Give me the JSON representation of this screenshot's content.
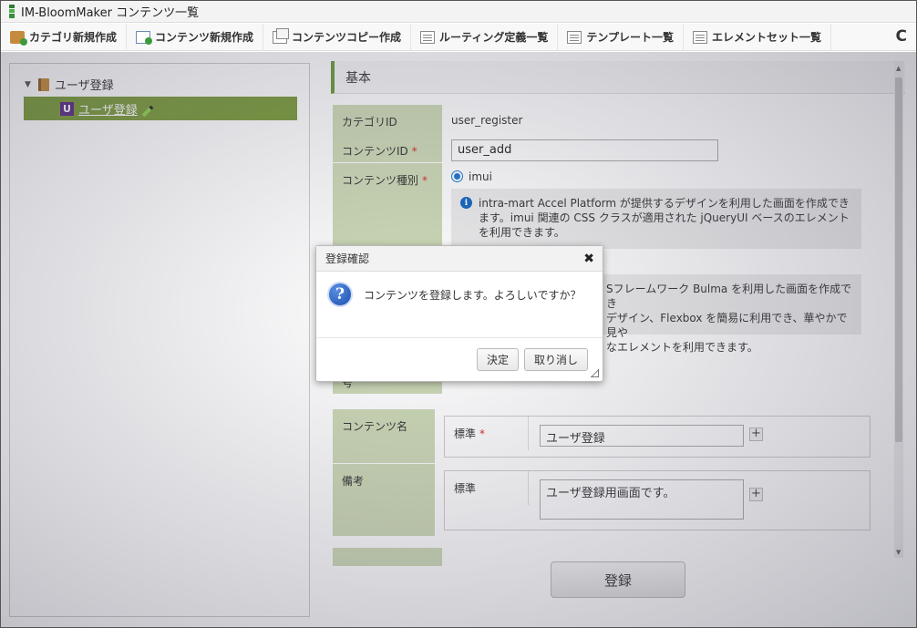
{
  "window": {
    "title": "IM-BloomMaker コンテンツ一覧"
  },
  "toolbar": {
    "items": [
      {
        "label": "カテゴリ新規作成",
        "icon": "category-new-icon"
      },
      {
        "label": "コンテンツ新規作成",
        "icon": "content-new-icon"
      },
      {
        "label": "コンテンツコピー作成",
        "icon": "content-copy-icon"
      },
      {
        "label": "ルーティング定義一覧",
        "icon": "list-icon"
      },
      {
        "label": "テンプレート一覧",
        "icon": "list-icon"
      },
      {
        "label": "エレメントセット一覧",
        "icon": "list-icon"
      }
    ],
    "refresh_glyph": "C"
  },
  "tree": {
    "root_label": "ユーザ登録",
    "child_badge": "U",
    "child_label": "ユーザ登録"
  },
  "form": {
    "section_title": "基本",
    "category_id_label": "カテゴリID",
    "category_id_value": "user_register",
    "content_id_label": "コンテンツID",
    "content_id_value": "user_add",
    "content_type_label": "コンテンツ種別",
    "content_type_option_imui": "imui",
    "imui_info": "intra-mart Accel Platform が提供するデザインを利用した画面を作成できます。imui 関連の CSS クラスが適用された jQueryUI ベースのエレメントを利用できます。",
    "bulma_info_line1": "Sフレームワーク Bulma を利用した画面を作成でき",
    "bulma_info_line2": "デザイン、Flexbox を簡易に利用でき、華やかで見や",
    "bulma_info_line3": "なエレメントを利用できます。",
    "partial_label": "号",
    "content_name_label": "コンテンツ名",
    "remarks_label": "備考",
    "lang_standard": "標準",
    "content_name_value": "ユーザ登録",
    "remarks_value": "ユーザ登録用画面です。",
    "required_mark": "*",
    "plus_glyph": "+",
    "register_button": "登録"
  },
  "dialog": {
    "title": "登録確認",
    "close_glyph": "✖",
    "question_glyph": "?",
    "message": "コンテンツを登録します。よろしいですか？",
    "ok_button": "決定",
    "cancel_button": "取り消し"
  },
  "colors": {
    "tree_selected": "#7a9a3a",
    "label_bg": "#cdd9b6",
    "section_accent": "#6a9a3a",
    "required": "#d32f2f"
  }
}
